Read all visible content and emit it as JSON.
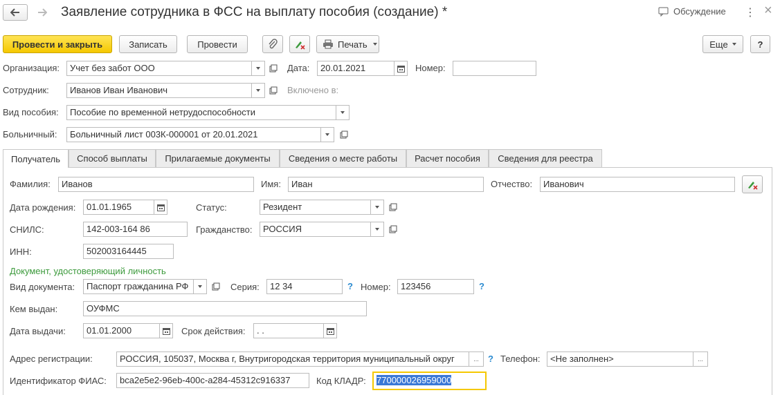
{
  "header": {
    "title": "Заявление сотрудника в ФСС на выплату пособия (создание) *",
    "discussion": "Обсуждение",
    "more_dots": "⋮",
    "close": "×"
  },
  "toolbar": {
    "post_close": "Провести и закрыть",
    "save": "Записать",
    "post": "Провести",
    "print": "Печать",
    "more": "Еще",
    "help": "?"
  },
  "header_fields": {
    "org_label": "Организация:",
    "org_value": "Учет без забот ООО",
    "date_label": "Дата:",
    "date_value": "20.01.2021",
    "number_label": "Номер:",
    "number_value": "",
    "employee_label": "Сотрудник:",
    "employee_value": "Иванов Иван Иванович",
    "included_label": "Включено в:",
    "benefit_label": "Вид пособия:",
    "benefit_value": "Пособие по временной нетрудоспособности",
    "sick_label": "Больничный:",
    "sick_value": "Больничный лист 003К-000001 от 20.01.2021"
  },
  "tabs": [
    {
      "label": "Получатель"
    },
    {
      "label": "Способ выплаты"
    },
    {
      "label": "Прилагаемые документы"
    },
    {
      "label": "Сведения о месте работы"
    },
    {
      "label": "Расчет пособия"
    },
    {
      "label": "Сведения для реестра"
    }
  ],
  "recipient": {
    "surname_label": "Фамилия:",
    "surname_value": "Иванов",
    "name_label": "Имя:",
    "name_value": "Иван",
    "patronymic_label": "Отчество:",
    "patronymic_value": "Иванович",
    "birth_label": "Дата рождения:",
    "birth_value": "01.01.1965",
    "status_label": "Статус:",
    "status_value": "Резидент",
    "snils_label": "СНИЛС:",
    "snils_value": "142-003-164 86",
    "citizenship_label": "Гражданство:",
    "citizenship_value": "РОССИЯ",
    "inn_label": "ИНН:",
    "inn_value": "502003164445",
    "id_doc_header": "Документ, удостоверяющий личность",
    "doc_type_label": "Вид документа:",
    "doc_type_value": "Паспорт гражданина РФ",
    "series_label": "Серия:",
    "series_value": "12 34",
    "doc_number_label": "Номер:",
    "doc_number_value": "123456",
    "issued_by_label": "Кем выдан:",
    "issued_by_value": "ОУФМС",
    "issue_date_label": "Дата выдачи:",
    "issue_date_value": "01.01.2000",
    "validity_label": "Срок действия:",
    "validity_value": " .  .",
    "address_label": "Адрес регистрации:",
    "address_value": "РОССИЯ, 105037, Москва г, Внутригородская территория муниципальный округ",
    "phone_label": "Телефон:",
    "phone_value": "<Не заполнен>",
    "fias_label": "Идентификатор ФИАС:",
    "fias_value": "bca2e5e2-96eb-400c-a284-45312c916337",
    "kladr_label": "Код КЛАДР:",
    "kladr_value": "770000026959000",
    "question": "?",
    "ellipsis": "..."
  },
  "colors": {
    "primary_button": "#f5c800",
    "section_header": "#3c9a3c",
    "help_question": "#2a8ad0",
    "kladr_focus_border": "#f5c800",
    "kladr_selection": "#3a78d6"
  }
}
